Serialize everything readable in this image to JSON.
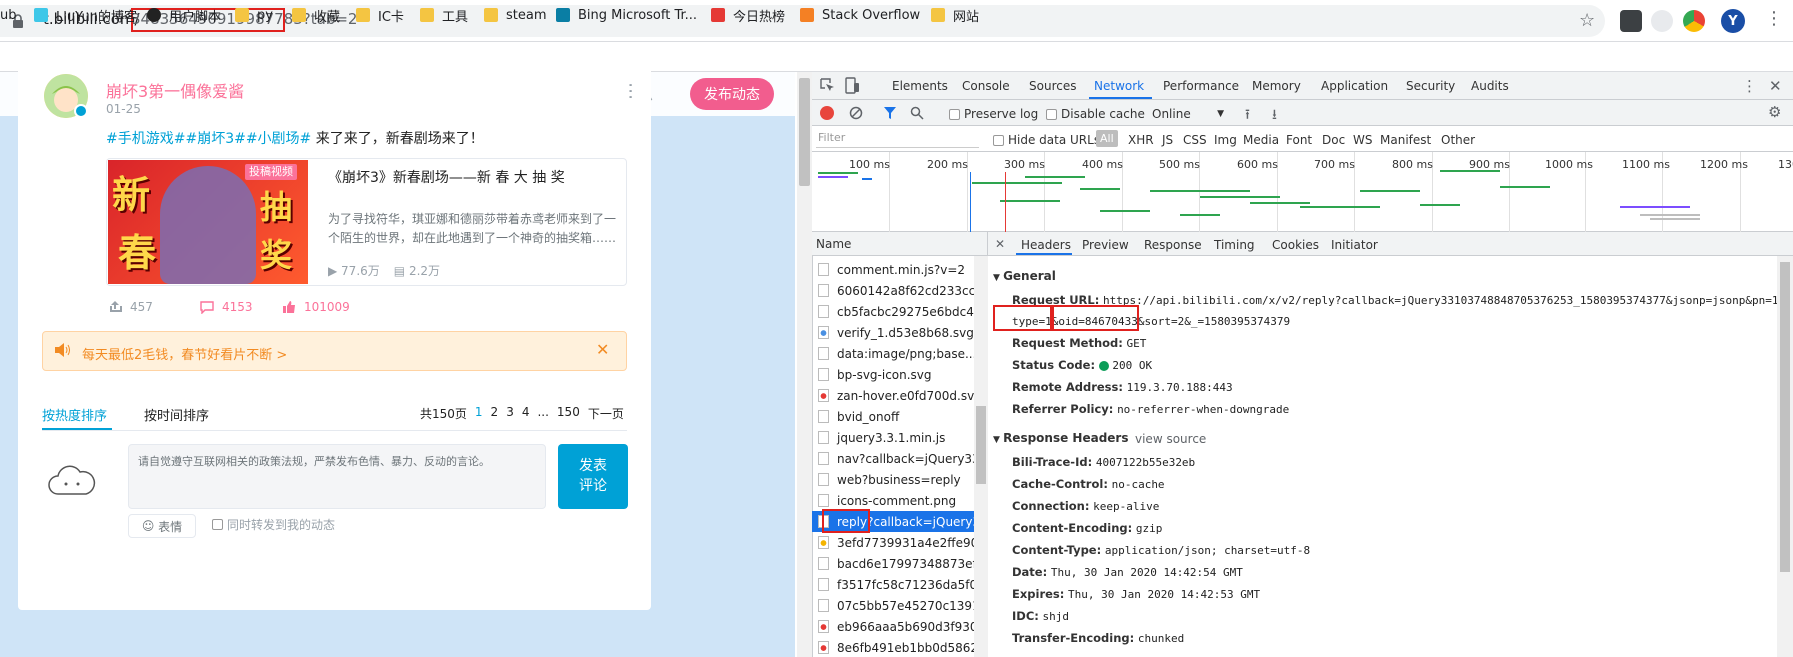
{
  "browser": {
    "url_host": "t.bilibili.com/",
    "url_path": "348356490919987783?tab=2",
    "avatar_letter": "Y"
  },
  "bookmarks": [
    {
      "label": "ub",
      "type": "none"
    },
    {
      "label": "LiuYun的博客",
      "type": "site"
    },
    {
      "label": "用户脚本",
      "type": "github"
    },
    {
      "label": "py",
      "type": "folder"
    },
    {
      "label": "收藏",
      "type": "folder"
    },
    {
      "label": "IC卡",
      "type": "folder"
    },
    {
      "label": "工具",
      "type": "folder"
    },
    {
      "label": "steam",
      "type": "folder"
    },
    {
      "label": "Bing Microsoft Tr...",
      "type": "bing"
    },
    {
      "label": "今日热榜",
      "type": "r"
    },
    {
      "label": "Stack Overflow",
      "type": "so"
    },
    {
      "label": "网站",
      "type": "folder"
    }
  ],
  "page": {
    "nav_message": "消息",
    "publish_button": "发布动态",
    "post": {
      "author": "崩坏3第一偶像爱酱",
      "date": "01-25",
      "tags": "#手机游戏##崩坏3##小剧场#",
      "text": " 来了来了，新春剧场来了！",
      "video": {
        "badge": "投稿视频",
        "title": "《崩坏3》新春剧场——新 春 大 抽 奖",
        "desc": "为了寻找符华，琪亚娜和德丽莎带着赤鸢老师来到了一个陌生的世界，却在此地遇到了一个神奇的抽奖箱……",
        "views": "77.6万",
        "danmaku": "2.2万",
        "thumb_left": "新",
        "thumb_left2": "春",
        "thumb_right": "抽",
        "thumb_right2": "奖"
      },
      "shares": "457",
      "comments": "4153",
      "likes": "101009"
    },
    "notice": "每天最低2毛钱，春节好看片不断 >",
    "sort_hot": "按热度排序",
    "sort_time": "按时间排序",
    "pager": {
      "total": "共150页",
      "pages": [
        "1",
        "2",
        "3",
        "4"
      ],
      "ellipsis": "...",
      "last": "150",
      "next": "下一页"
    },
    "comment_placeholder": "请自觉遵守互联网相关的政策法规，严禁发布色情、暴力、反动的言论。",
    "comment_button_line1": "发表",
    "comment_button_line2": "评论",
    "emoji_button": "表情",
    "sync_label": "同时转发到我的动态"
  },
  "devtools": {
    "tabs": [
      "Elements",
      "Console",
      "Sources",
      "Network",
      "Performance",
      "Memory",
      "Application",
      "Security",
      "Audits"
    ],
    "active_tab": "Network",
    "toolbar": {
      "preserve_log": "Preserve log",
      "disable_cache": "Disable cache",
      "throttle": "Online"
    },
    "filter_placeholder": "Filter",
    "hide_data_urls": "Hide data URLs",
    "filter_types": [
      "All",
      "XHR",
      "JS",
      "CSS",
      "Img",
      "Media",
      "Font",
      "Doc",
      "WS",
      "Manifest",
      "Other"
    ],
    "timeline_labels": [
      "100 ms",
      "200 ms",
      "300 ms",
      "400 ms",
      "500 ms",
      "600 ms",
      "700 ms",
      "800 ms",
      "900 ms",
      "1000 ms",
      "1100 ms",
      "1200 ms",
      "130"
    ],
    "name_header": "Name",
    "requests": [
      "comment.min.js?v=2",
      "6060142a8f62cd233cc574",
      "cb5facbc29275e6bdc4cfa",
      "verify_1.d53e8b68.svg",
      "data:image/png;base...",
      "bp-svg-icon.svg",
      "zan-hover.e0fd700d.svg",
      "bvid_onoff",
      "jquery3.3.1.min.js",
      "nav?callback=jQuery3310",
      "web?business=reply",
      "icons-comment.png",
      "reply?callback=jQuery331",
      "3efd7739931a4e2ffe908b",
      "bacd6e17997348873ef89.",
      "f3517fc58c71236da5f035.",
      "07c5bb57e45270c139172",
      "eb966aaa5b690d3f9308a",
      "8e6fb491eb1bb0d5862e7"
    ],
    "selected_request_index": 12,
    "detail_tabs": [
      "Headers",
      "Preview",
      "Response",
      "Timing",
      "Cookies",
      "Initiator"
    ],
    "general_title": "General",
    "general": {
      "request_url_label": "Request URL:",
      "request_url_line1": "https://api.bilibili.com/x/v2/reply?callback=jQuery33103748848705376253_1580395374377&jsonp=jsonp&pn=1&",
      "request_url_l2a": "type=1&",
      "request_url_l2b": "oid=84670433",
      "request_url_l2c": "&sort=2&_=1580395374379",
      "method_label": "Request Method:",
      "method": "GET",
      "status_label": "Status Code:",
      "status": "200 OK",
      "remote_label": "Remote Address:",
      "remote": "119.3.70.188:443",
      "referrer_label": "Referrer Policy:",
      "referrer": "no-referrer-when-downgrade"
    },
    "response_title": "Response Headers",
    "view_source": "view source",
    "response_headers": [
      {
        "k": "Bili-Trace-Id:",
        "v": "4007122b55e32eb"
      },
      {
        "k": "Cache-Control:",
        "v": "no-cache"
      },
      {
        "k": "Connection:",
        "v": "keep-alive"
      },
      {
        "k": "Content-Encoding:",
        "v": "gzip"
      },
      {
        "k": "Content-Type:",
        "v": "application/json; charset=utf-8"
      },
      {
        "k": "Date:",
        "v": "Thu, 30 Jan 2020 14:42:54 GMT"
      },
      {
        "k": "Expires:",
        "v": "Thu, 30 Jan 2020 14:42:53 GMT"
      },
      {
        "k": "IDC:",
        "v": "shjd"
      },
      {
        "k": "Transfer-Encoding:",
        "v": "chunked"
      }
    ]
  }
}
